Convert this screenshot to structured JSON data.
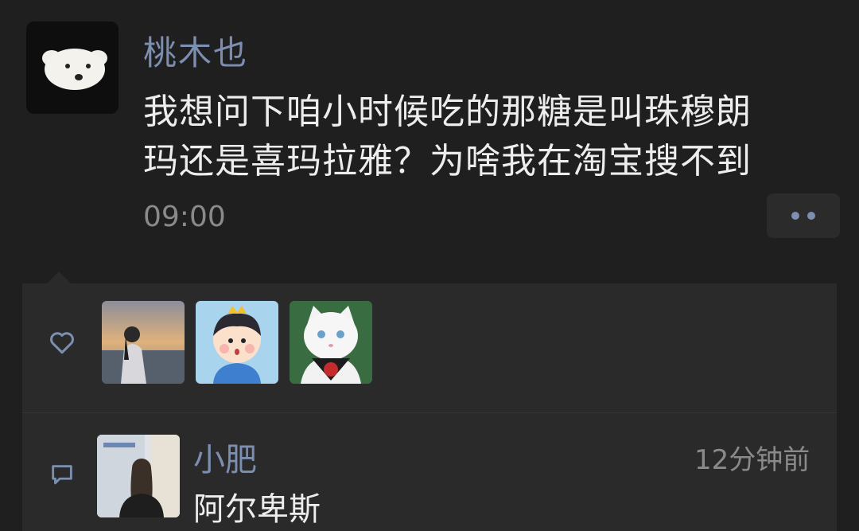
{
  "post": {
    "author_name": "桃木也",
    "content_line1": "我想问下咱小时候吃的那糖是叫珠穆朗",
    "content_line2": "玛还是喜玛拉雅？为啥我在淘宝搜不到",
    "time": "09:00"
  },
  "likes": {
    "icon": "heart-outline-icon",
    "avatars": [
      "sunset-girl-avatar",
      "cartoon-boy-crown-avatar",
      "white-cat-avatar"
    ]
  },
  "comment": {
    "icon": "comment-bubble-icon",
    "author_name": "小肥",
    "time": "12分钟前",
    "text": "阿尔卑斯"
  },
  "colors": {
    "background": "#1f1f1f",
    "panel": "#2a2a2a",
    "link_blue": "#7d8fb1",
    "text": "#ededed",
    "muted": "#8a8a8a"
  }
}
